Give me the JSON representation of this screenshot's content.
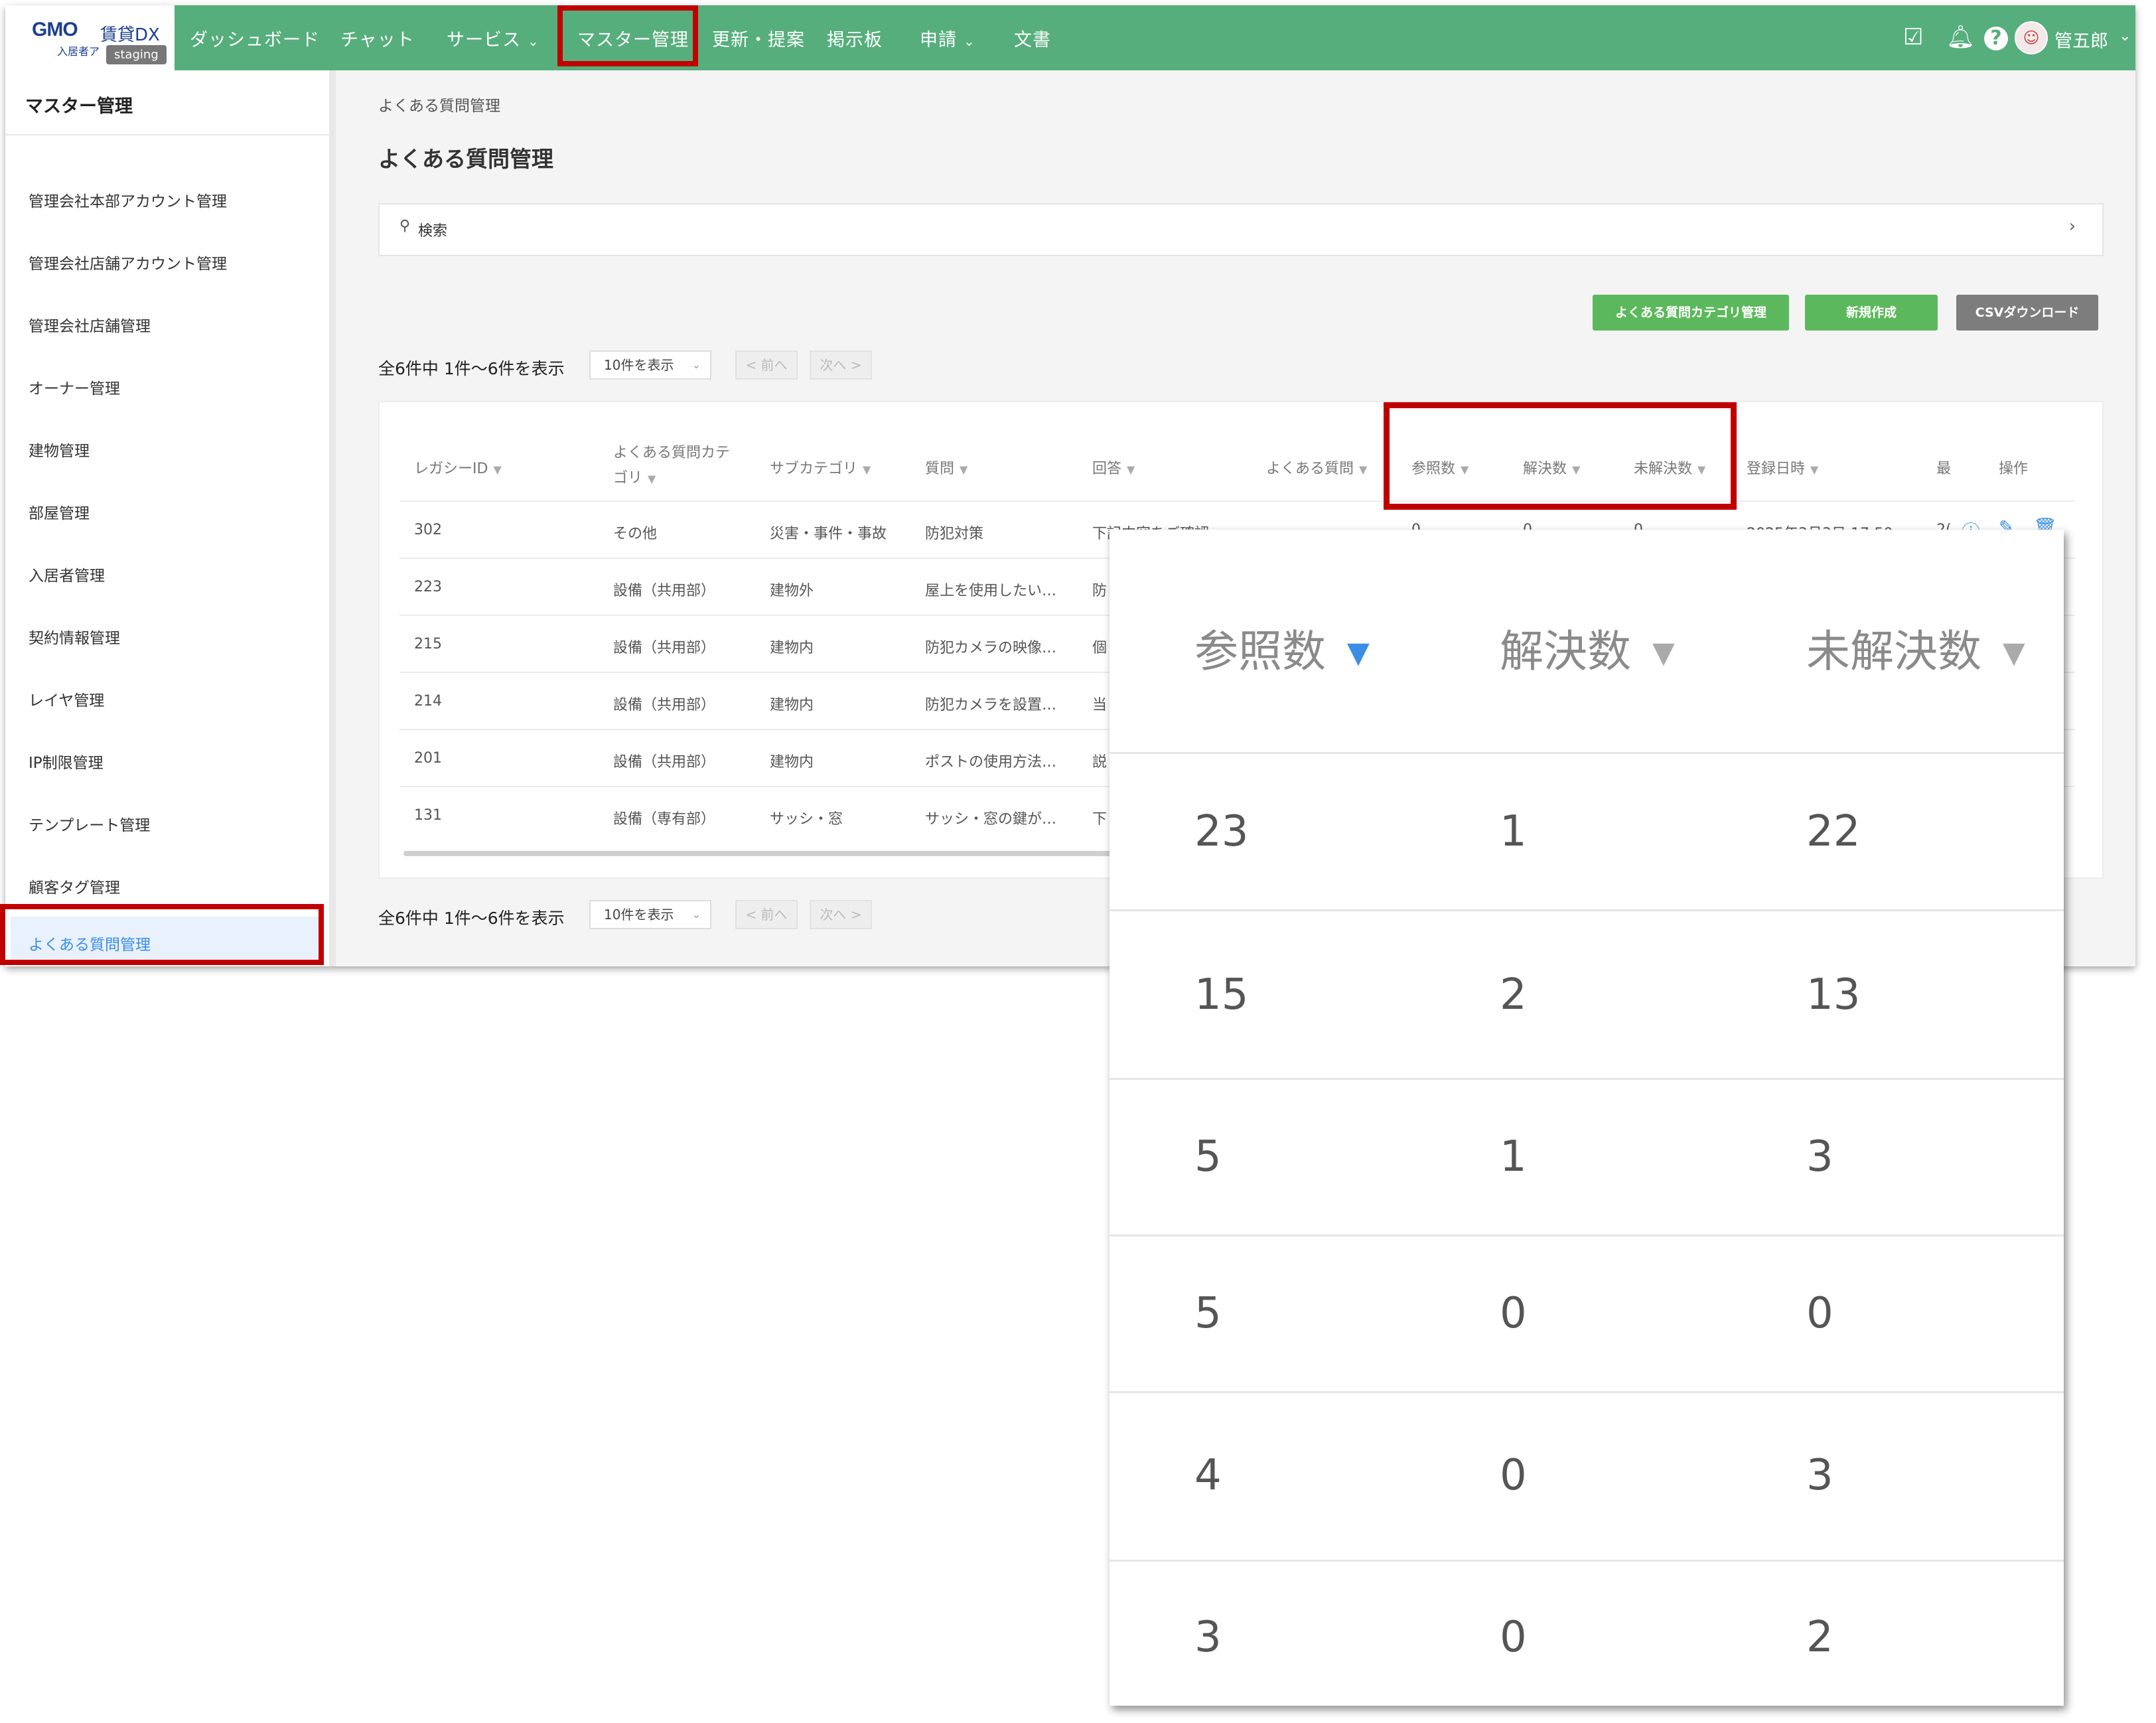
{
  "logo": {
    "brand": "GMO",
    "product": "賃貸DX",
    "sub": "入居者ア",
    "env_badge": "staging"
  },
  "nav": {
    "items": [
      {
        "label": "ダッシュボード",
        "has_dropdown": false
      },
      {
        "label": "チャット",
        "has_dropdown": false
      },
      {
        "label": "サービス",
        "has_dropdown": true
      },
      {
        "label": "マスター管理",
        "has_dropdown": false,
        "active": true
      },
      {
        "label": "更新・提案",
        "has_dropdown": false
      },
      {
        "label": "掲示板",
        "has_dropdown": false
      },
      {
        "label": "申請",
        "has_dropdown": true
      },
      {
        "label": "文書",
        "has_dropdown": false
      }
    ],
    "user_name": "管五郎"
  },
  "sidebar": {
    "title": "マスター管理",
    "items": [
      {
        "label": "管理会社本部アカウント管理"
      },
      {
        "label": "管理会社店舗アカウント管理"
      },
      {
        "label": "管理会社店舗管理"
      },
      {
        "label": "オーナー管理"
      },
      {
        "label": "建物管理"
      },
      {
        "label": "部屋管理"
      },
      {
        "label": "入居者管理"
      },
      {
        "label": "契約情報管理"
      },
      {
        "label": "レイヤ管理"
      },
      {
        "label": "IP制限管理"
      },
      {
        "label": "テンプレート管理"
      },
      {
        "label": "顧客タグ管理"
      },
      {
        "label": "よくある質問管理",
        "active": true
      }
    ]
  },
  "main": {
    "breadcrumb": "よくある質問管理",
    "title": "よくある質問管理",
    "search_label": "検索",
    "buttons": {
      "category": "よくある質問カテゴリ管理",
      "create": "新規作成",
      "csv": "CSVダウンロード"
    },
    "pager": {
      "count_text": "全6件中 1件〜6件を表示",
      "per_page": "10件を表示",
      "prev": "< 前へ",
      "next": "次へ >"
    },
    "table": {
      "headers": {
        "legacy_id": "レガシーID",
        "category_l1": "よくある質問カテ",
        "category_l2": "ゴリ",
        "subcategory": "サブカテゴリ",
        "question": "質問",
        "answer": "回答",
        "faq": "よくある質問",
        "views": "参照数",
        "resolved": "解決数",
        "unresolved": "未解決数",
        "registered": "登録日時",
        "truncated": "最",
        "actions": "操作"
      },
      "rows": [
        {
          "id": "302",
          "category": "その他",
          "subcategory": "災害・事件・事故",
          "question": "防犯対策",
          "answer": "下記内容をご確認…",
          "views": "0",
          "resolved": "0",
          "unresolved": "0",
          "registered": "2025年3月3日 17:50",
          "extra": "2("
        },
        {
          "id": "223",
          "category": "設備（共用部）",
          "subcategory": "建物外",
          "question": "屋上を使用したい…",
          "answer": "防"
        },
        {
          "id": "215",
          "category": "設備（共用部）",
          "subcategory": "建物内",
          "question": "防犯カメラの映像…",
          "answer": "個"
        },
        {
          "id": "214",
          "category": "設備（共用部）",
          "subcategory": "建物内",
          "question": "防犯カメラを設置…",
          "answer": "当"
        },
        {
          "id": "201",
          "category": "設備（共用部）",
          "subcategory": "建物内",
          "question": "ポストの使用方法…",
          "answer": "説"
        },
        {
          "id": "131",
          "category": "設備（専有部）",
          "subcategory": "サッシ・窓",
          "question": "サッシ・窓の鍵が…",
          "answer": "下"
        }
      ]
    }
  },
  "zoom": {
    "headers": {
      "views": "参照数",
      "resolved": "解決数",
      "unresolved": "未解決数"
    },
    "rows": [
      {
        "views": "23",
        "resolved": "1",
        "unresolved": "22"
      },
      {
        "views": "15",
        "resolved": "2",
        "unresolved": "13"
      },
      {
        "views": "5",
        "resolved": "1",
        "unresolved": "3"
      },
      {
        "views": "5",
        "resolved": "0",
        "unresolved": "0"
      },
      {
        "views": "4",
        "resolved": "0",
        "unresolved": "3"
      },
      {
        "views": "3",
        "resolved": "0",
        "unresolved": "2"
      }
    ]
  },
  "colors": {
    "topbar": "#56ae7c",
    "highlight": "#c00000",
    "button_green": "#5cb85c",
    "button_gray": "#7d7d7d",
    "sort_active": "#3a8ee6"
  },
  "icons": [
    "check-calendar-icon",
    "bell-icon",
    "help-icon",
    "avatar",
    "search-icon",
    "chevron-right-icon",
    "info-icon",
    "edit-icon",
    "trash-icon",
    "sort-caret-icon"
  ]
}
